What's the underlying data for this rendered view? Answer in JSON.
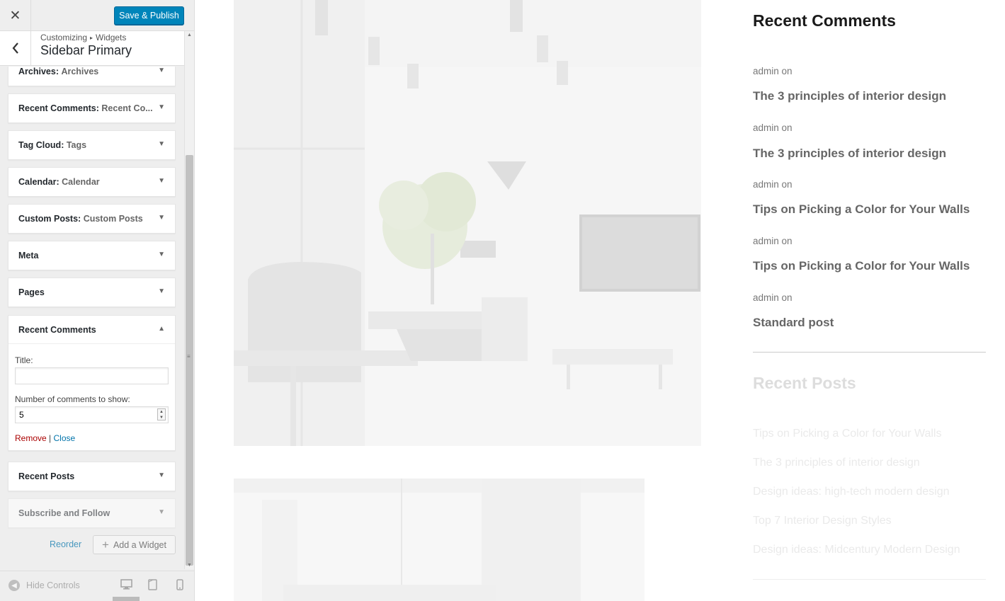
{
  "topbar": {
    "save_label": "Save & Publish"
  },
  "section": {
    "breadcrumb": [
      "Customizing",
      "Widgets"
    ],
    "title": "Sidebar Primary"
  },
  "widgets": [
    {
      "name": "Archives",
      "title": "Archives"
    },
    {
      "name": "Recent Comments",
      "title": "Recent Co..."
    },
    {
      "name": "Tag Cloud",
      "title": "Tags"
    },
    {
      "name": "Calendar",
      "title": "Calendar"
    },
    {
      "name": "Custom Posts",
      "title": "Custom Posts"
    },
    {
      "name": "Meta",
      "title": ""
    },
    {
      "name": "Pages",
      "title": ""
    },
    {
      "name": "Recent Comments",
      "title": ""
    },
    {
      "name": "Recent Posts",
      "title": ""
    },
    {
      "name": "Subscribe and Follow",
      "title": ""
    }
  ],
  "open_widget": {
    "title_label": "Title:",
    "title_value": "",
    "number_label": "Number of comments to show:",
    "number_value": "5",
    "remove_label": "Remove",
    "separator": "|",
    "close_label": "Close"
  },
  "actions": {
    "reorder_label": "Reorder",
    "add_widget_label": "Add a Widget"
  },
  "footer": {
    "hide_controls_label": "Hide Controls"
  },
  "preview": {
    "recent_comments": {
      "heading": "Recent Comments",
      "items": [
        {
          "meta": "admin on",
          "link": "The 3 principles of interior design"
        },
        {
          "meta": "admin on",
          "link": "The 3 principles of interior design"
        },
        {
          "meta": "admin on",
          "link": "Tips on Picking a Color for Your Walls"
        },
        {
          "meta": "admin on",
          "link": "Tips on Picking a Color for Your Walls"
        },
        {
          "meta": "admin on",
          "link": "Standard post"
        }
      ]
    },
    "recent_posts": {
      "heading": "Recent Posts",
      "items": [
        "Tips on Picking a Color for Your Walls",
        "The 3 principles of interior design",
        "Design ideas: high-tech modern design",
        "Top 7 Interior Design Styles",
        "Design ideas: Midcentury Modern Design"
      ]
    }
  },
  "colors": {
    "primary_button": "#0085ba",
    "link": "#0073aa",
    "remove": "#aa0000"
  }
}
